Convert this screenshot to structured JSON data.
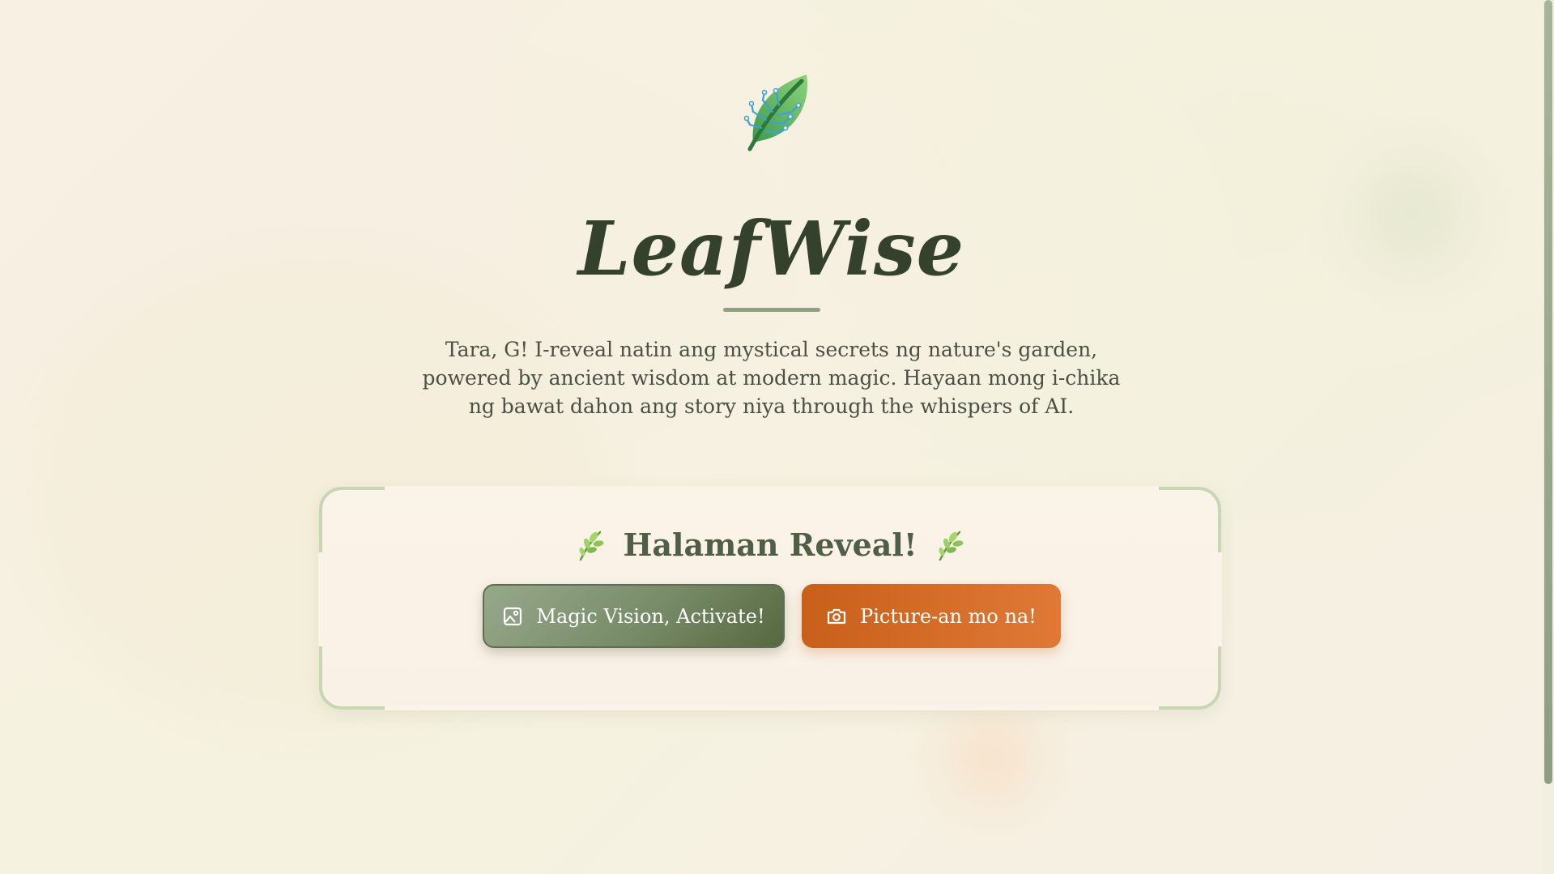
{
  "hero": {
    "logo_icon": "leaf-circuit-logo-icon",
    "title": "LeafWise",
    "tagline": "Tara, G! I-reveal natin ang mystical secrets ng nature's garden, powered by ancient wisdom at modern magic. Hayaan mong i-chika ng bawat dahon ang story niya through the whispers of AI."
  },
  "card": {
    "title": "Halaman Reveal!",
    "left_icon": "sprig-icon",
    "right_icon": "sprig-icon",
    "buttons": {
      "vision_label": "Magic Vision, Activate!",
      "vision_icon": "image-icon",
      "picture_label": "Picture-an mo na!",
      "picture_icon": "camera-icon"
    }
  },
  "colors": {
    "accent_green": "#788b68",
    "accent_orange": "#d76b27",
    "title_dark": "#34412d",
    "background": "#f7f1e2"
  }
}
